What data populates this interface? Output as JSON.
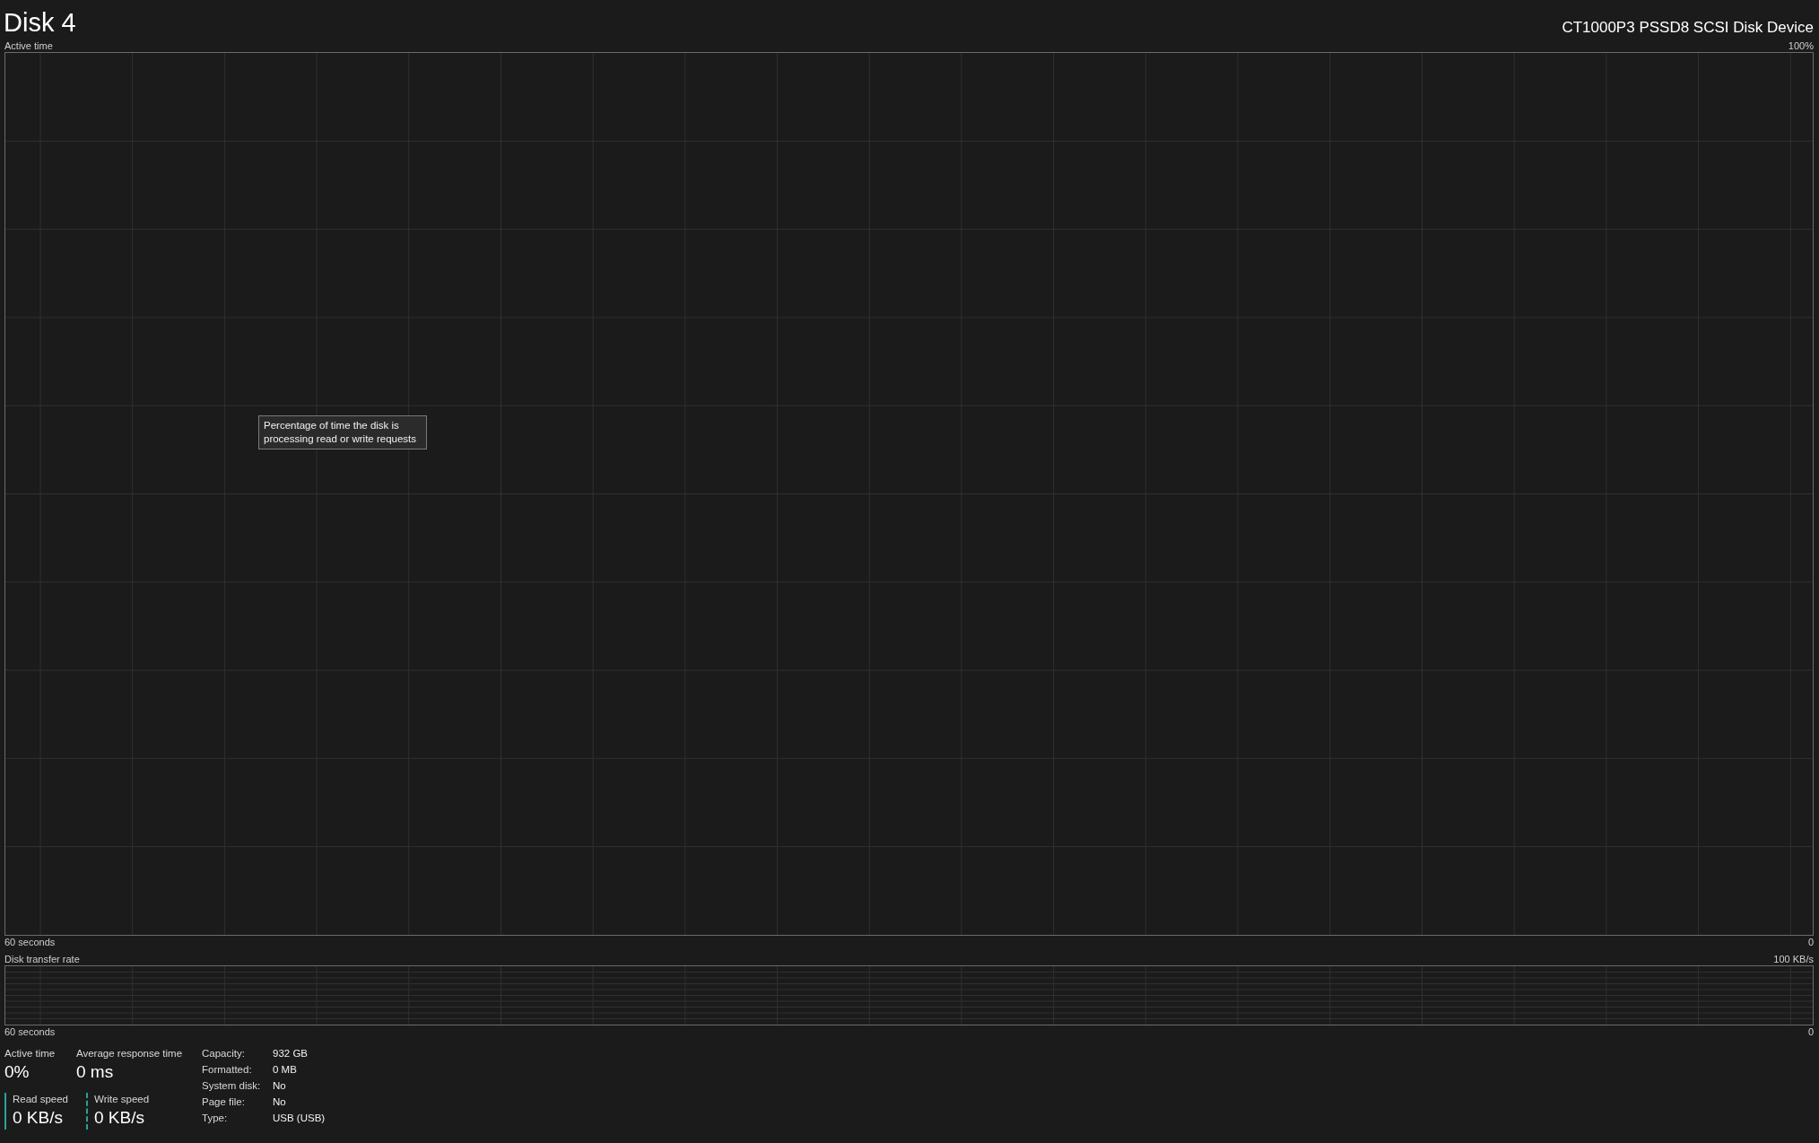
{
  "title": "Disk 4",
  "device": "CT1000P3 PSSD8 SCSI Disk Device",
  "active_chart": {
    "label": "Active time",
    "max": "100%",
    "time_span": "60 seconds",
    "min": "0",
    "tooltip": "Percentage of time the disk is processing read or write requests"
  },
  "transfer_chart": {
    "label": "Disk transfer rate",
    "max": "100 KB/s",
    "time_span": "60 seconds",
    "min": "0"
  },
  "metrics": [
    {
      "label": "Active time",
      "value": "0%"
    },
    {
      "label": "Average response time",
      "value": "0 ms"
    }
  ],
  "speeds": [
    {
      "label": "Read speed",
      "value": "0 KB/s",
      "kind": "solid"
    },
    {
      "label": "Write speed",
      "value": "0 KB/s",
      "kind": "dashed"
    }
  ],
  "properties": [
    {
      "label": "Capacity:",
      "value": "932 GB"
    },
    {
      "label": "Formatted:",
      "value": "0 MB"
    },
    {
      "label": "System disk:",
      "value": "No"
    },
    {
      "label": "Page file:",
      "value": "No"
    },
    {
      "label": "Type:",
      "value": "USB (USB)"
    }
  ]
}
